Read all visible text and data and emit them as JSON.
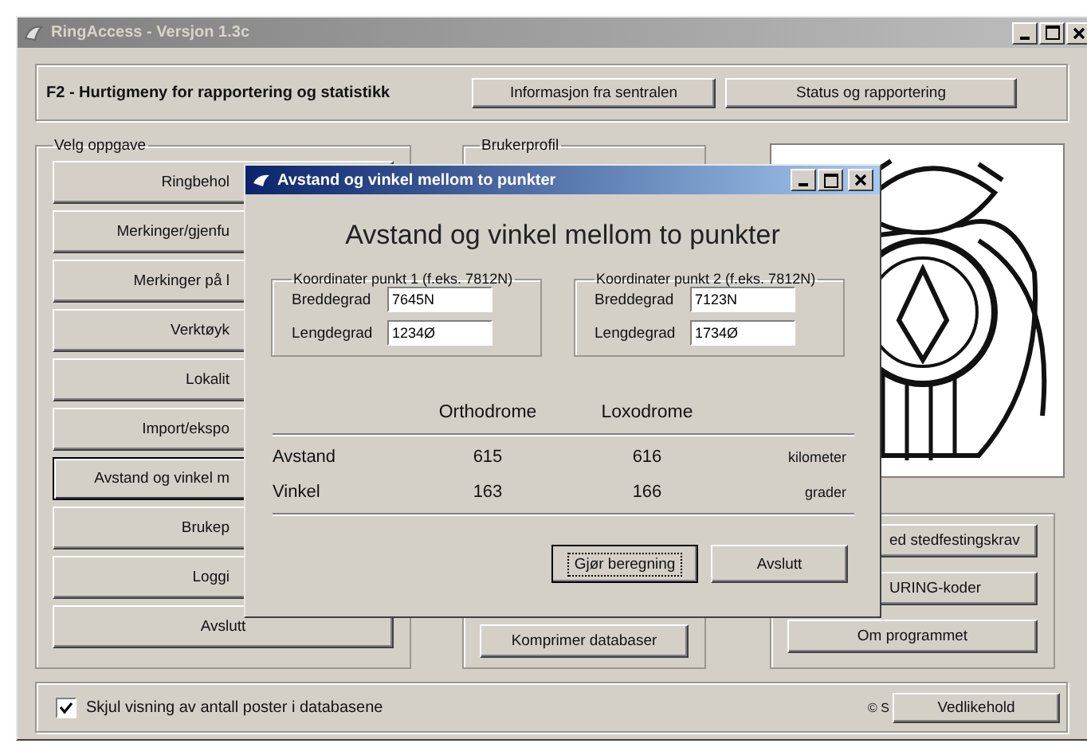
{
  "window": {
    "title": "RingAccess - Versjon 1.3c"
  },
  "header": {
    "title": "F2 - Hurtigmeny for rapportering og statistikk",
    "buttons": [
      "Informasjon fra sentralen",
      "Status og rapportering"
    ]
  },
  "task_group": {
    "title": "Velg oppgave",
    "buttons": [
      {
        "label": "Ringbehol",
        "selected": false
      },
      {
        "label": "Merkinger/gjenfu",
        "selected": false
      },
      {
        "label": "Merkinger på l",
        "selected": false
      },
      {
        "label": "Verktøyk",
        "selected": false
      },
      {
        "label": "Lokalit",
        "selected": false
      },
      {
        "label": "Import/ekspo",
        "selected": false
      },
      {
        "label": "Avstand og vinkel m",
        "selected": true
      },
      {
        "label": "Brukep",
        "selected": false
      },
      {
        "label": "Loggi",
        "selected": false
      },
      {
        "label": "Avslutt",
        "selected": false
      }
    ]
  },
  "profile_group": {
    "title": "Brukerprofil",
    "buttons": [
      "Komprimer databaser"
    ]
  },
  "right_group": {
    "buttons": [
      "ed stedfestingskrav",
      "URING-koder",
      "Om programmet"
    ]
  },
  "footer": {
    "checkbox": {
      "label": "Skjul visning av antall poster i databasene",
      "checked": true
    },
    "copyright": "© S",
    "button": "Vedlikehold"
  },
  "dialog": {
    "title": "Avstand og vinkel mellom to punkter",
    "heading": "Avstand og vinkel mellom to punkter",
    "points": [
      {
        "title": "Koordinater punkt 1 (f.eks. 7812N)",
        "fields": [
          {
            "label": "Breddegrad",
            "value": "7645N"
          },
          {
            "label": "Lengdegrad",
            "value": "1234Ø"
          }
        ]
      },
      {
        "title": "Koordinater punkt 2 (f.eks. 7812N)",
        "fields": [
          {
            "label": "Breddegrad",
            "value": "7123N"
          },
          {
            "label": "Lengdegrad",
            "value": "1734Ø"
          }
        ]
      }
    ],
    "columns": [
      "Orthodrome",
      "Loxodrome"
    ],
    "rows": [
      {
        "label": "Avstand",
        "values": [
          "615",
          "616"
        ],
        "unit": "kilometer"
      },
      {
        "label": "Vinkel",
        "values": [
          "163",
          "166"
        ],
        "unit": "grader"
      }
    ],
    "buttons": [
      {
        "label": "Gjør beregning",
        "default": true
      },
      {
        "label": "Avslutt",
        "default": false
      }
    ]
  }
}
